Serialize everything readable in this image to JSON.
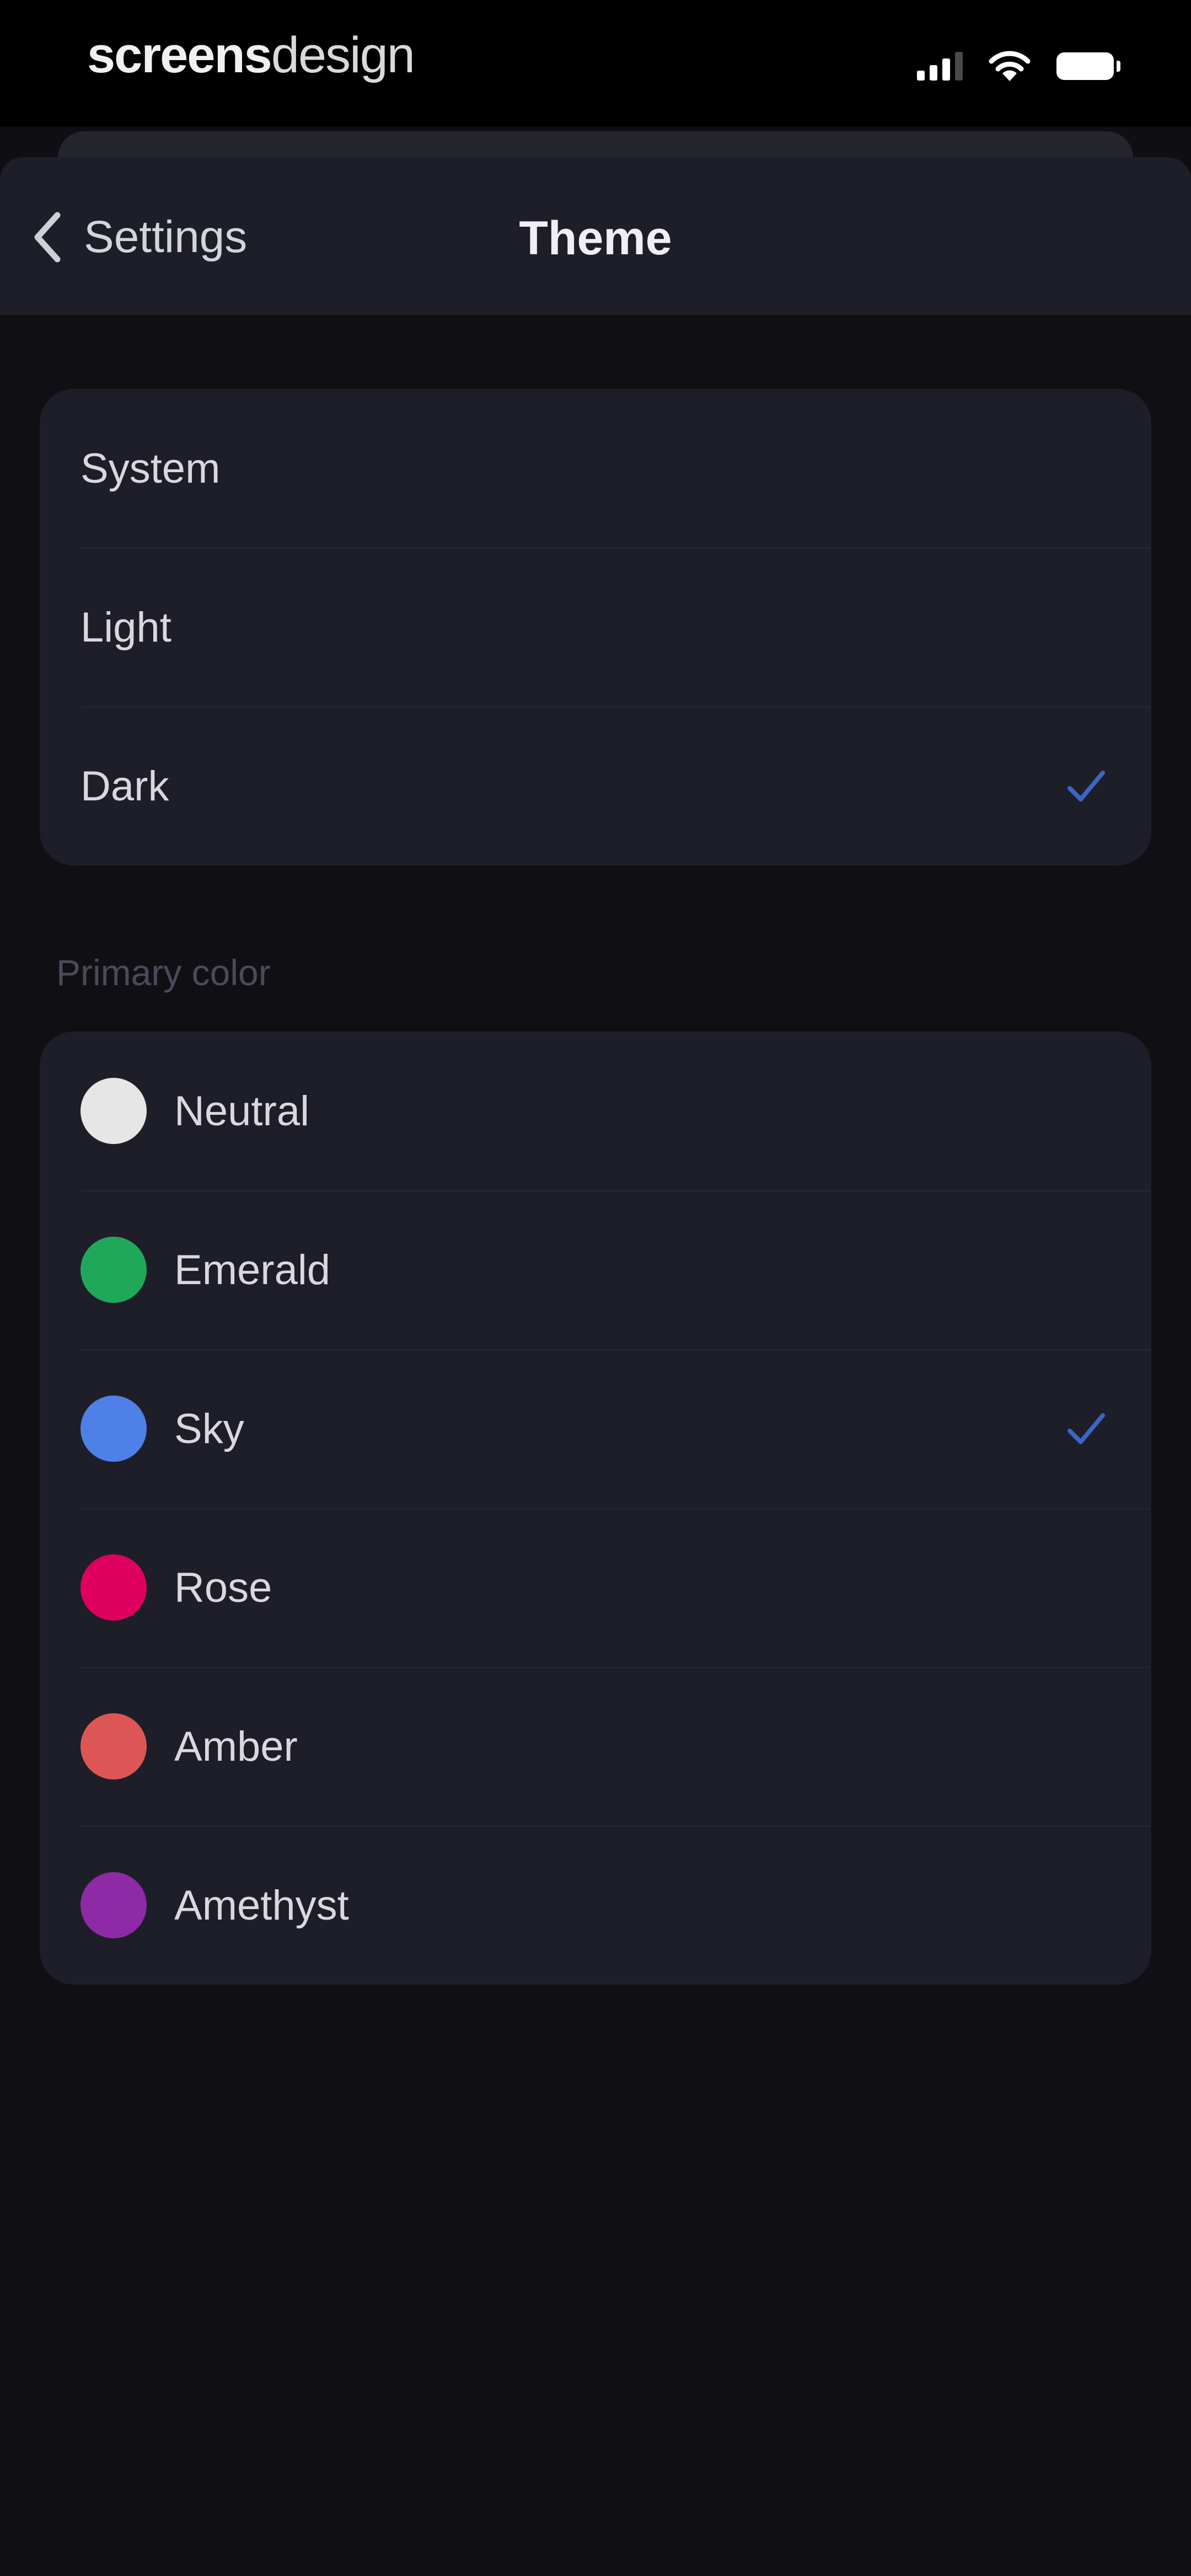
{
  "status_bar": {
    "brand_part1": "screens",
    "brand_part2": "design",
    "icons": [
      "signal-icon",
      "wifi-icon",
      "battery-icon"
    ]
  },
  "nav": {
    "back_label": "Settings",
    "title": "Theme"
  },
  "theme_options": [
    {
      "label": "System",
      "selected": false
    },
    {
      "label": "Light",
      "selected": false
    },
    {
      "label": "Dark",
      "selected": true
    }
  ],
  "primary_color_label": "Primary color",
  "colors": [
    {
      "label": "Neutral",
      "swatch": "#e6e6e6",
      "selected": false
    },
    {
      "label": "Emerald",
      "swatch": "#20a85a",
      "selected": false
    },
    {
      "label": "Sky",
      "swatch": "#4f80e8",
      "selected": true
    },
    {
      "label": "Rose",
      "swatch": "#e0005f",
      "selected": false
    },
    {
      "label": "Amber",
      "swatch": "#dc5656",
      "selected": false
    },
    {
      "label": "Amethyst",
      "swatch": "#8e2aa6",
      "selected": false
    }
  ],
  "accent_color": "#3a66c4"
}
